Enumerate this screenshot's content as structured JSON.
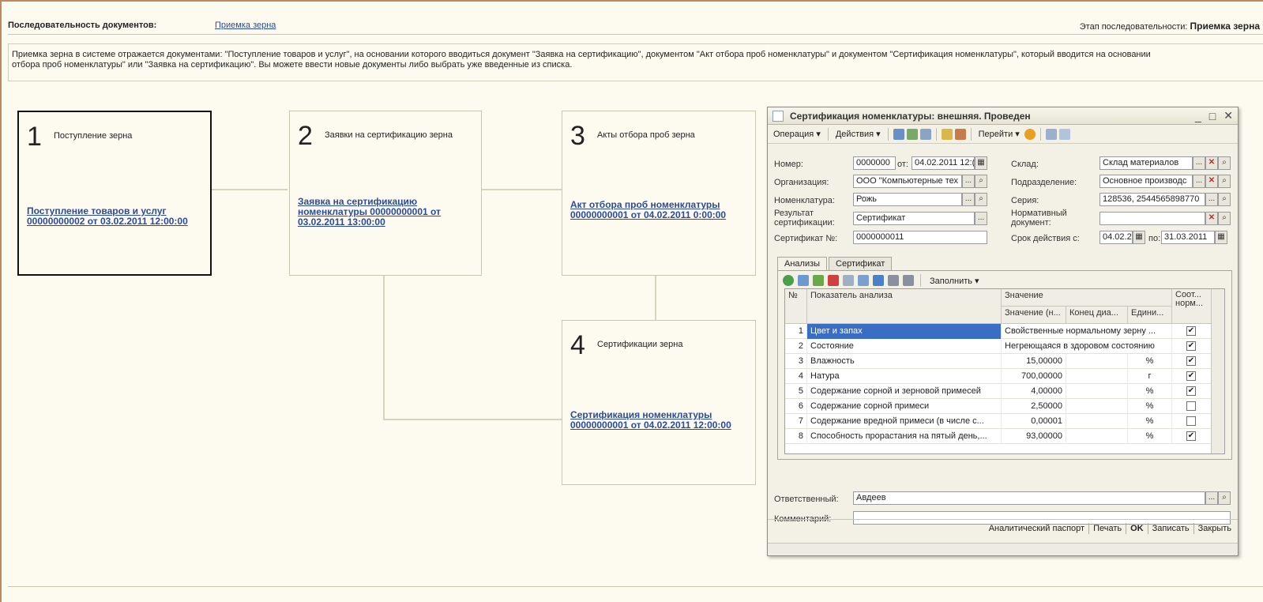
{
  "header": {
    "label": "Последовательность документов:",
    "link": "Приемка зерна",
    "stage_label": "Этап последовательности:",
    "stage_value": "Приемка зерна"
  },
  "description": "Приемка зерна в системе отражается документами: \"Поступление товаров и услуг\", на основании которого вводиться документ \"Заявка на сертификацию\", документом \"Акт отбора проб номенклатуры\" и документом \"Сертификация номенклатуры\", который вводится на основании\nотбора проб номенклатуры\" или \"Заявка на сертификацию\". Вы можете ввести новые документы либо выбрать уже введенные из списка.",
  "steps": [
    {
      "num": "1",
      "title": "Поступление зерна",
      "link": "Поступление товаров и услуг 00000000002 от 03.02.2011 12:00:00"
    },
    {
      "num": "2",
      "title": "Заявки на сертификацию зерна",
      "link": "Заявка на сертификацию номенклатуры 00000000001 от 03.02.2011 13:00:00"
    },
    {
      "num": "3",
      "title": "Акты отбора проб зерна",
      "link": "Акт отбора проб номенклатуры 00000000001 от 04.02.2011 0:00:00"
    },
    {
      "num": "4",
      "title": "Сертификации зерна",
      "link": "Сертификация номенклатуры 00000000001 от 04.02.2011 12:00:00"
    }
  ],
  "window": {
    "title": "Сертификация номенклатуры: внешняя. Проведен",
    "controls": {
      "minimize": "_",
      "maximize": "□",
      "close": "✕"
    },
    "toolbar": {
      "operation": "Операция ▾",
      "actions": "Действия ▾",
      "goto": "Перейти ▾"
    },
    "fields": {
      "number_label": "Номер:",
      "number": "0000000",
      "from_label": "от:",
      "date": "04.02.2011 12:(",
      "warehouse_label": "Склад:",
      "warehouse": "Склад материалов",
      "org_label": "Организация:",
      "org": "ООО \"Компьютерные тех",
      "dept_label": "Подразделение:",
      "dept": "Основное производс",
      "nom_label": "Номенклатура:",
      "nom": "Рожь",
      "series_label": "Серия:",
      "series": "128536, 2544565898770",
      "result_label": "Результат сертификации:",
      "result": "Сертификат",
      "normdoc_label": "Нормативный документ:",
      "normdoc": "",
      "cert_label": "Сертификат №:",
      "cert": "0000000011",
      "validity_label": "Срок действия с:",
      "valid_from": "04.02.2",
      "to_label": "по:",
      "valid_to": "31.03.2011"
    },
    "tabs": [
      "Анализы",
      "Сертификат"
    ],
    "table_toolbar": {
      "fill": "Заполнить ▾"
    },
    "columns": {
      "no": "№",
      "indicator": "Показатель анализа",
      "value": "Значение",
      "value_start": "Значение (н...",
      "range_end": "Конец диа...",
      "unit": "Едини...",
      "conform": "Соот... норм..."
    },
    "rows": [
      {
        "n": "1",
        "name": "Цвет и запах",
        "value": "Свойственные нормальному зерну ...",
        "unit": "",
        "checked": true,
        "wide": true
      },
      {
        "n": "2",
        "name": "Состояние",
        "value": "Негреющаяся в здоровом состоянию",
        "unit": "",
        "checked": true,
        "wide": true
      },
      {
        "n": "3",
        "name": "Влажность",
        "value": "15,00000",
        "unit": "%",
        "checked": true,
        "wide": false
      },
      {
        "n": "4",
        "name": "Натура",
        "value": "700,00000",
        "unit": "г",
        "checked": true,
        "wide": false
      },
      {
        "n": "5",
        "name": "Содержание сорной и зерновой примесей",
        "value": "4,00000",
        "unit": "%",
        "checked": true,
        "wide": false
      },
      {
        "n": "6",
        "name": "Содержание сорной примеси",
        "value": "2,50000",
        "unit": "%",
        "checked": false,
        "wide": false
      },
      {
        "n": "7",
        "name": "Содержание вредной примеси (в числе с...",
        "value": "0,00001",
        "unit": "%",
        "checked": false,
        "wide": false
      },
      {
        "n": "8",
        "name": "Способность прорастания на пятый день,...",
        "value": "93,00000",
        "unit": "%",
        "checked": true,
        "wide": false
      }
    ],
    "responsible_label": "Ответственный:",
    "responsible": "Авдеев",
    "comment_label": "Комментарий:",
    "comment": "",
    "buttons": {
      "passport": "Аналитический паспорт",
      "print": "Печать",
      "ok": "OK",
      "save": "Записать",
      "close": "Закрыть"
    }
  }
}
